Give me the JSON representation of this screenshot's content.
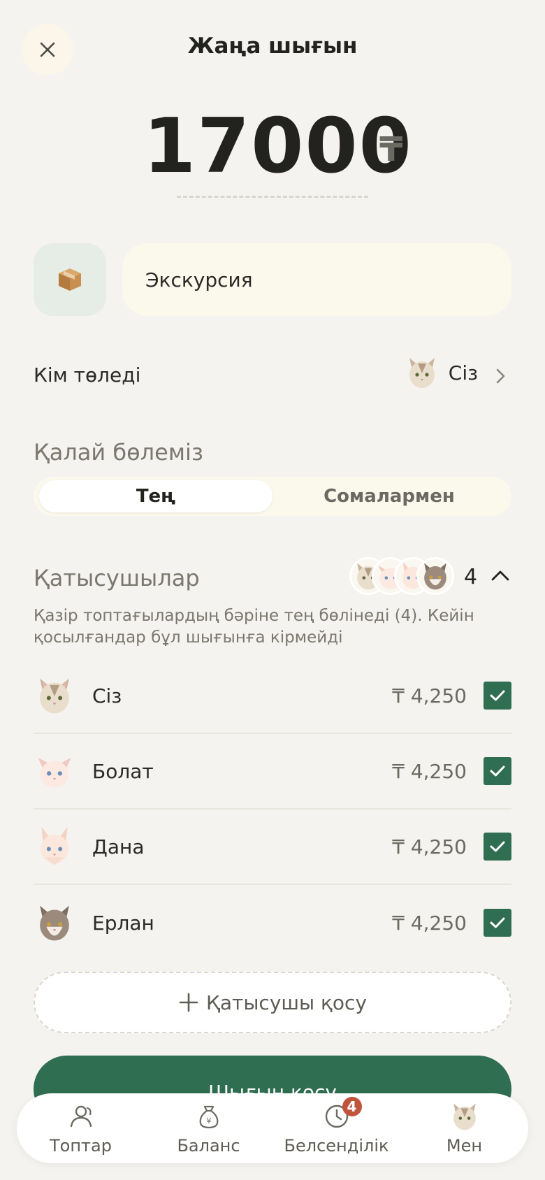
{
  "header": {
    "title": "Жаңа шығын"
  },
  "amount": {
    "value": "17000",
    "currency": "₸"
  },
  "description": {
    "value": "Экскурсия"
  },
  "payer": {
    "label": "Кім төледі",
    "name": "Сіз"
  },
  "split": {
    "label": "Қалай бөлеміз",
    "options": [
      "Тең",
      "Сомалармен"
    ],
    "selected": "Тең"
  },
  "participants": {
    "label": "Қатысушылар",
    "count": "4",
    "hint": "Қазір топтағылардың бәріне тең бөлінеді (4). Кейін қосылғандар бұл шығынға кірмейді",
    "items": [
      {
        "name": "Сіз",
        "amount": "₸ 4,250",
        "checked": true
      },
      {
        "name": "Болат",
        "amount": "₸ 4,250",
        "checked": true
      },
      {
        "name": "Дана",
        "amount": "₸ 4,250",
        "checked": true
      },
      {
        "name": "Ерлан",
        "amount": "₸ 4,250",
        "checked": true
      }
    ],
    "add_label": "Қатысушы қосу"
  },
  "submit": {
    "label": "Шығын қосу"
  },
  "tabbar": {
    "items": [
      {
        "label": "Топтар",
        "icon": "people-icon"
      },
      {
        "label": "Баланс",
        "icon": "money-bag-icon"
      },
      {
        "label": "Белсенділік",
        "icon": "clock-icon",
        "badge": "4"
      },
      {
        "label": "Мен",
        "icon": "cat-avatar-icon"
      }
    ]
  },
  "colors": {
    "accent": "#2f6e50",
    "badge": "#c0533c",
    "background": "#f5f3ef"
  }
}
